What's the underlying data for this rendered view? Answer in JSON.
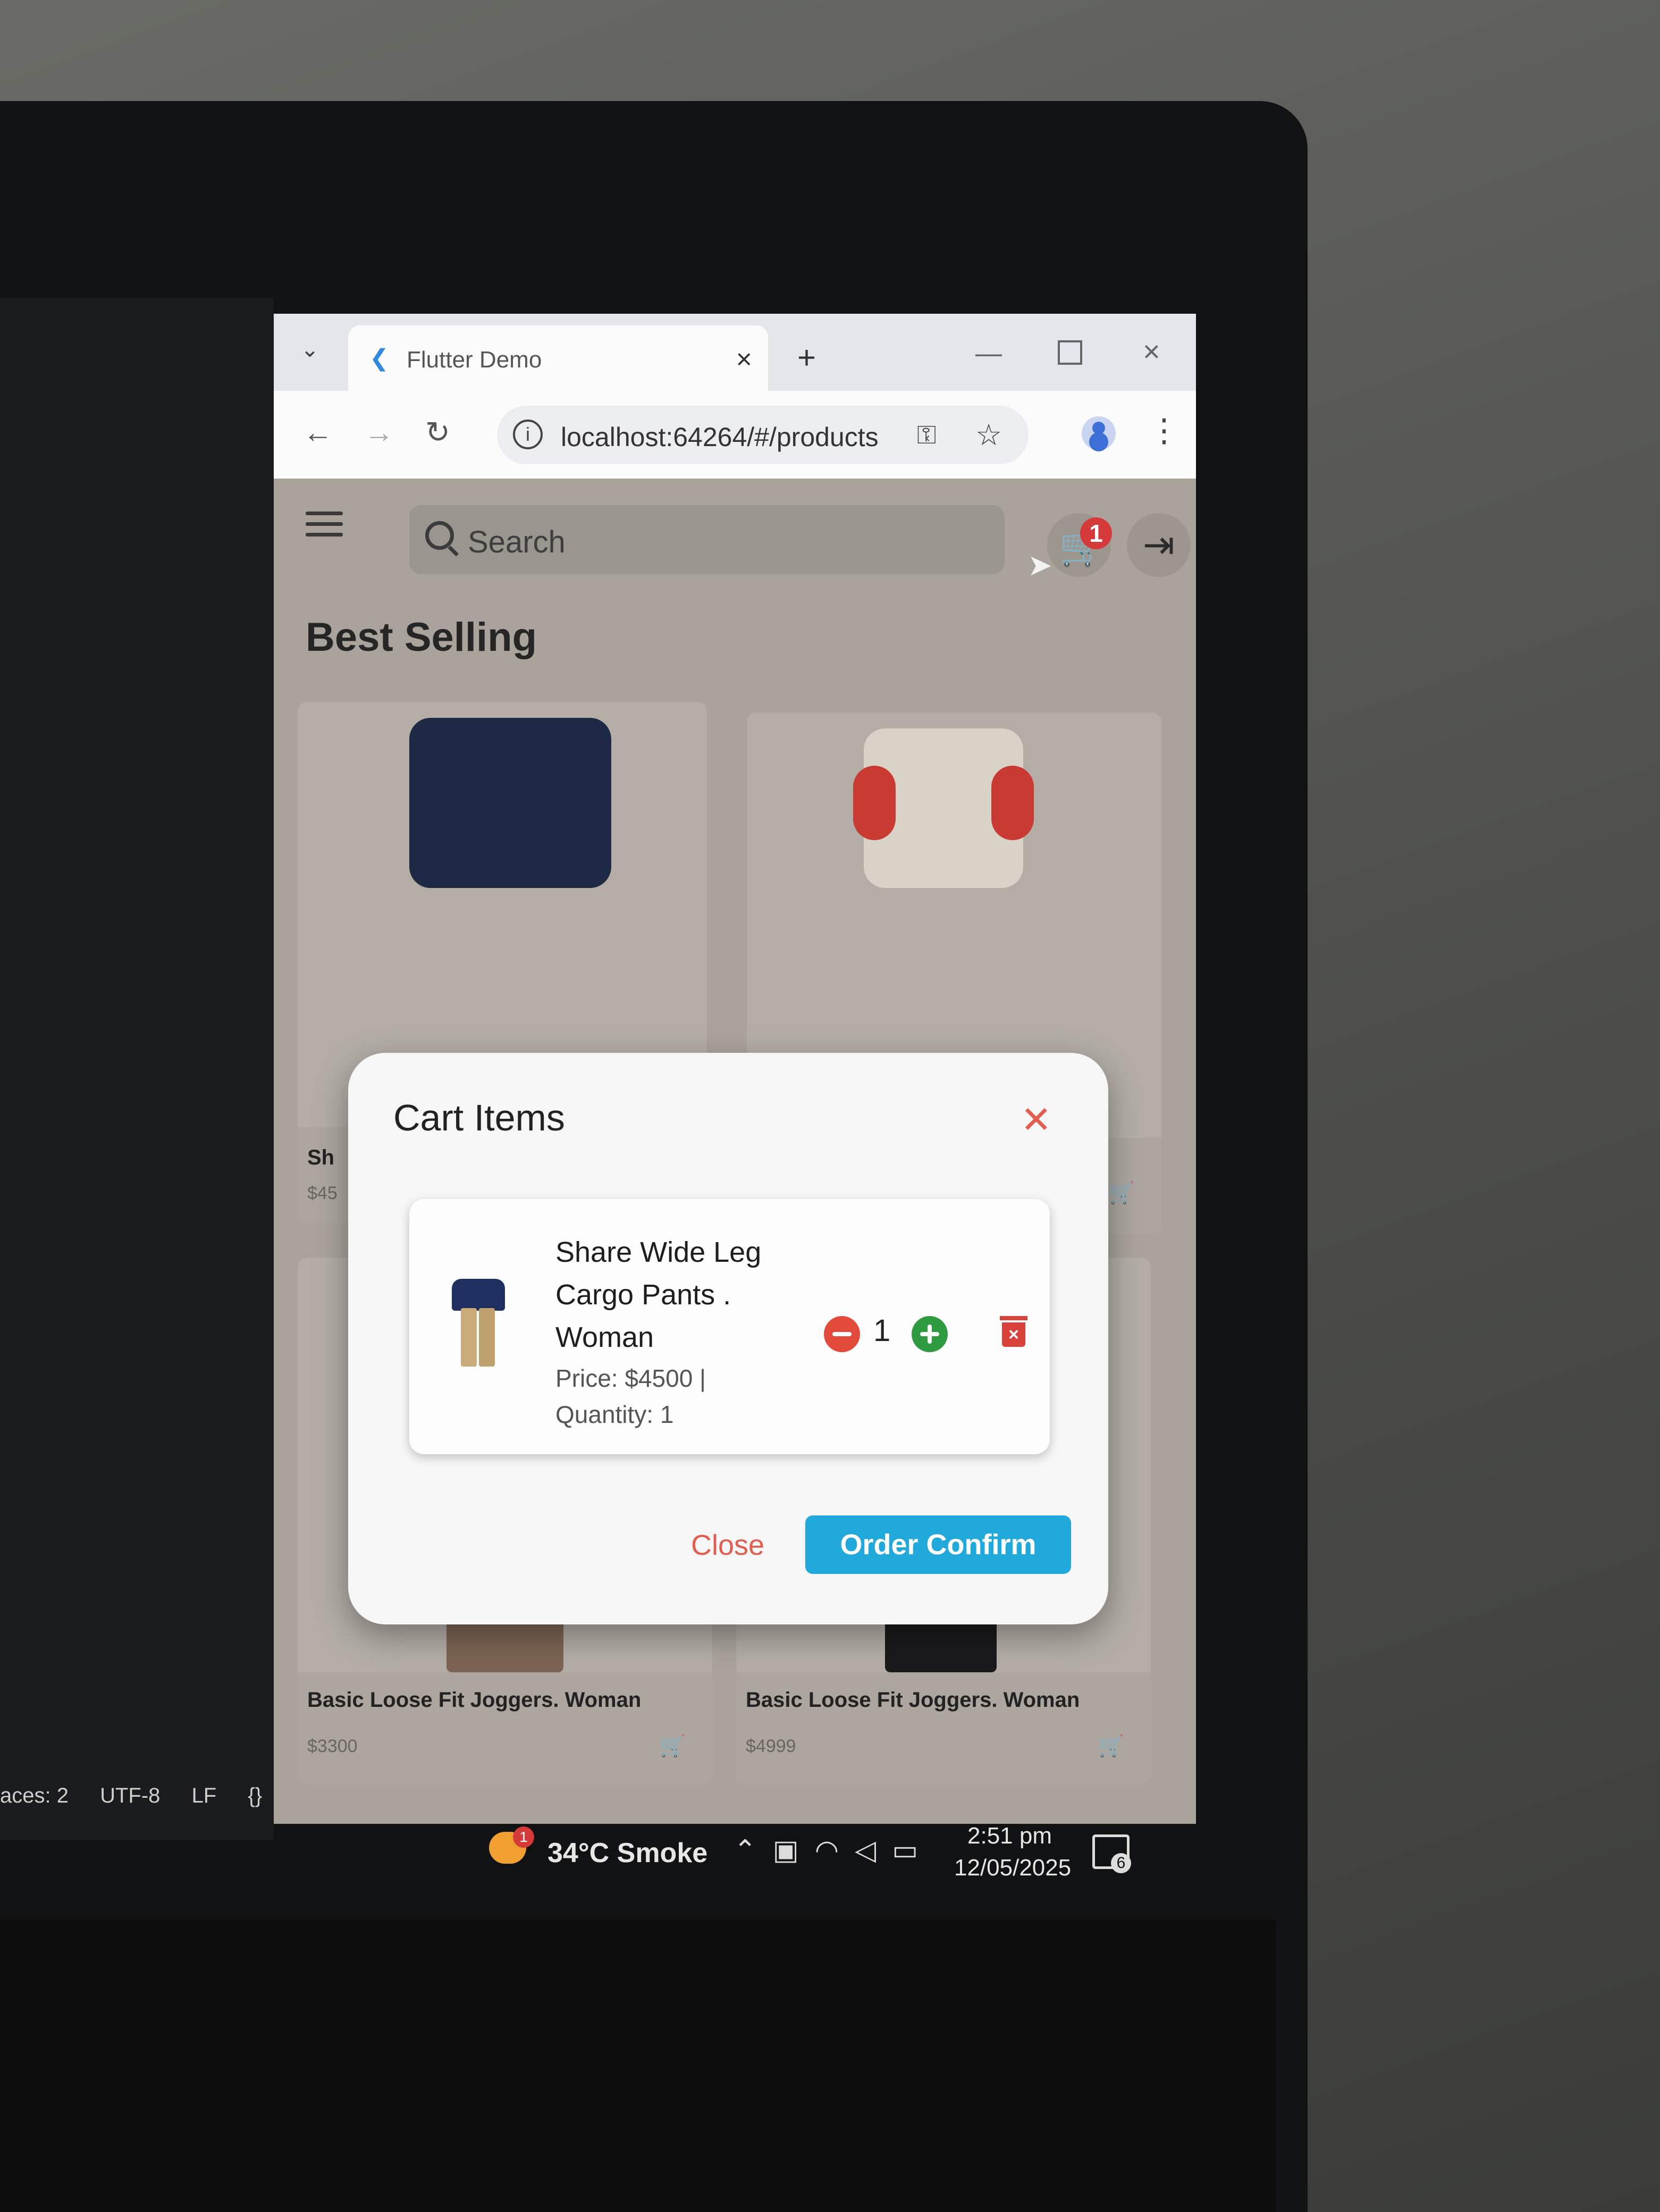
{
  "browser": {
    "tab_title": "Flutter Demo",
    "url": "localhost:64264/#/products",
    "tab_logo_icon": "flutter-logo-icon"
  },
  "app": {
    "search_placeholder": "Search",
    "cart_badge_count": "1",
    "section_title": "Best Selling"
  },
  "products": [
    {
      "name": "Sh",
      "price": "$45"
    },
    {
      "name": "",
      "price": ""
    },
    {
      "name": "Basic Loose Fit Joggers. Woman",
      "price": "$3300"
    },
    {
      "name": "Basic Loose Fit Joggers. Woman",
      "price": "$4999"
    }
  ],
  "dialog": {
    "title": "Cart Items",
    "item": {
      "name": " Share Wide Leg Cargo Pants . Woman",
      "price_line": "Price: $4500 |",
      "quantity_line": "Quantity: 1",
      "quantity": "1"
    },
    "close_label": "Close",
    "confirm_label": "Order Confirm"
  },
  "side_editor_status": [
    "aces: 2",
    "UTF-8",
    "LF",
    "{}"
  ],
  "taskbar": {
    "weather": "34°C Smoke",
    "weather_badge": "1",
    "time": "2:51 pm",
    "date": "12/05/2025",
    "notifications": "6"
  },
  "colors": {
    "accent": "#22a9dc",
    "danger": "#e25d50",
    "increment": "#2e9b41"
  }
}
